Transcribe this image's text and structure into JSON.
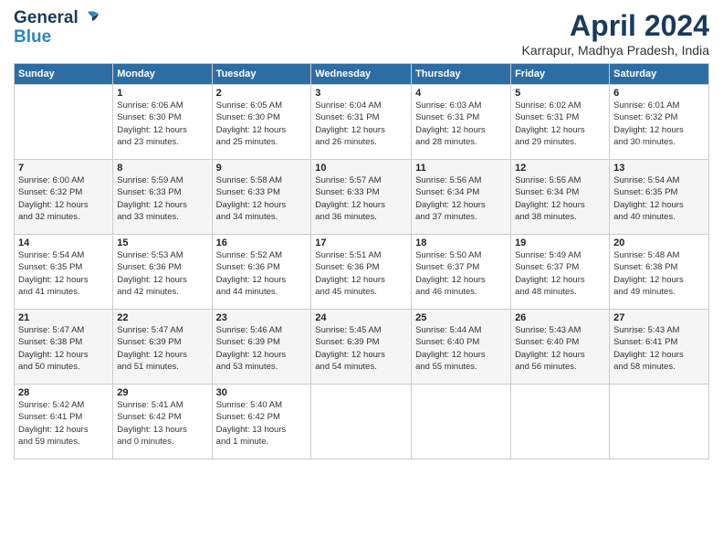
{
  "header": {
    "logo_line1": "General",
    "logo_line2": "Blue",
    "month_title": "April 2024",
    "location": "Karrapur, Madhya Pradesh, India"
  },
  "days_of_week": [
    "Sunday",
    "Monday",
    "Tuesday",
    "Wednesday",
    "Thursday",
    "Friday",
    "Saturday"
  ],
  "weeks": [
    [
      {
        "day": "",
        "info": ""
      },
      {
        "day": "1",
        "info": "Sunrise: 6:06 AM\nSunset: 6:30 PM\nDaylight: 12 hours\nand 23 minutes."
      },
      {
        "day": "2",
        "info": "Sunrise: 6:05 AM\nSunset: 6:30 PM\nDaylight: 12 hours\nand 25 minutes."
      },
      {
        "day": "3",
        "info": "Sunrise: 6:04 AM\nSunset: 6:31 PM\nDaylight: 12 hours\nand 26 minutes."
      },
      {
        "day": "4",
        "info": "Sunrise: 6:03 AM\nSunset: 6:31 PM\nDaylight: 12 hours\nand 28 minutes."
      },
      {
        "day": "5",
        "info": "Sunrise: 6:02 AM\nSunset: 6:31 PM\nDaylight: 12 hours\nand 29 minutes."
      },
      {
        "day": "6",
        "info": "Sunrise: 6:01 AM\nSunset: 6:32 PM\nDaylight: 12 hours\nand 30 minutes."
      }
    ],
    [
      {
        "day": "7",
        "info": "Sunrise: 6:00 AM\nSunset: 6:32 PM\nDaylight: 12 hours\nand 32 minutes."
      },
      {
        "day": "8",
        "info": "Sunrise: 5:59 AM\nSunset: 6:33 PM\nDaylight: 12 hours\nand 33 minutes."
      },
      {
        "day": "9",
        "info": "Sunrise: 5:58 AM\nSunset: 6:33 PM\nDaylight: 12 hours\nand 34 minutes."
      },
      {
        "day": "10",
        "info": "Sunrise: 5:57 AM\nSunset: 6:33 PM\nDaylight: 12 hours\nand 36 minutes."
      },
      {
        "day": "11",
        "info": "Sunrise: 5:56 AM\nSunset: 6:34 PM\nDaylight: 12 hours\nand 37 minutes."
      },
      {
        "day": "12",
        "info": "Sunrise: 5:55 AM\nSunset: 6:34 PM\nDaylight: 12 hours\nand 38 minutes."
      },
      {
        "day": "13",
        "info": "Sunrise: 5:54 AM\nSunset: 6:35 PM\nDaylight: 12 hours\nand 40 minutes."
      }
    ],
    [
      {
        "day": "14",
        "info": "Sunrise: 5:54 AM\nSunset: 6:35 PM\nDaylight: 12 hours\nand 41 minutes."
      },
      {
        "day": "15",
        "info": "Sunrise: 5:53 AM\nSunset: 6:36 PM\nDaylight: 12 hours\nand 42 minutes."
      },
      {
        "day": "16",
        "info": "Sunrise: 5:52 AM\nSunset: 6:36 PM\nDaylight: 12 hours\nand 44 minutes."
      },
      {
        "day": "17",
        "info": "Sunrise: 5:51 AM\nSunset: 6:36 PM\nDaylight: 12 hours\nand 45 minutes."
      },
      {
        "day": "18",
        "info": "Sunrise: 5:50 AM\nSunset: 6:37 PM\nDaylight: 12 hours\nand 46 minutes."
      },
      {
        "day": "19",
        "info": "Sunrise: 5:49 AM\nSunset: 6:37 PM\nDaylight: 12 hours\nand 48 minutes."
      },
      {
        "day": "20",
        "info": "Sunrise: 5:48 AM\nSunset: 6:38 PM\nDaylight: 12 hours\nand 49 minutes."
      }
    ],
    [
      {
        "day": "21",
        "info": "Sunrise: 5:47 AM\nSunset: 6:38 PM\nDaylight: 12 hours\nand 50 minutes."
      },
      {
        "day": "22",
        "info": "Sunrise: 5:47 AM\nSunset: 6:39 PM\nDaylight: 12 hours\nand 51 minutes."
      },
      {
        "day": "23",
        "info": "Sunrise: 5:46 AM\nSunset: 6:39 PM\nDaylight: 12 hours\nand 53 minutes."
      },
      {
        "day": "24",
        "info": "Sunrise: 5:45 AM\nSunset: 6:39 PM\nDaylight: 12 hours\nand 54 minutes."
      },
      {
        "day": "25",
        "info": "Sunrise: 5:44 AM\nSunset: 6:40 PM\nDaylight: 12 hours\nand 55 minutes."
      },
      {
        "day": "26",
        "info": "Sunrise: 5:43 AM\nSunset: 6:40 PM\nDaylight: 12 hours\nand 56 minutes."
      },
      {
        "day": "27",
        "info": "Sunrise: 5:43 AM\nSunset: 6:41 PM\nDaylight: 12 hours\nand 58 minutes."
      }
    ],
    [
      {
        "day": "28",
        "info": "Sunrise: 5:42 AM\nSunset: 6:41 PM\nDaylight: 12 hours\nand 59 minutes."
      },
      {
        "day": "29",
        "info": "Sunrise: 5:41 AM\nSunset: 6:42 PM\nDaylight: 13 hours\nand 0 minutes."
      },
      {
        "day": "30",
        "info": "Sunrise: 5:40 AM\nSunset: 6:42 PM\nDaylight: 13 hours\nand 1 minute."
      },
      {
        "day": "",
        "info": ""
      },
      {
        "day": "",
        "info": ""
      },
      {
        "day": "",
        "info": ""
      },
      {
        "day": "",
        "info": ""
      }
    ]
  ]
}
